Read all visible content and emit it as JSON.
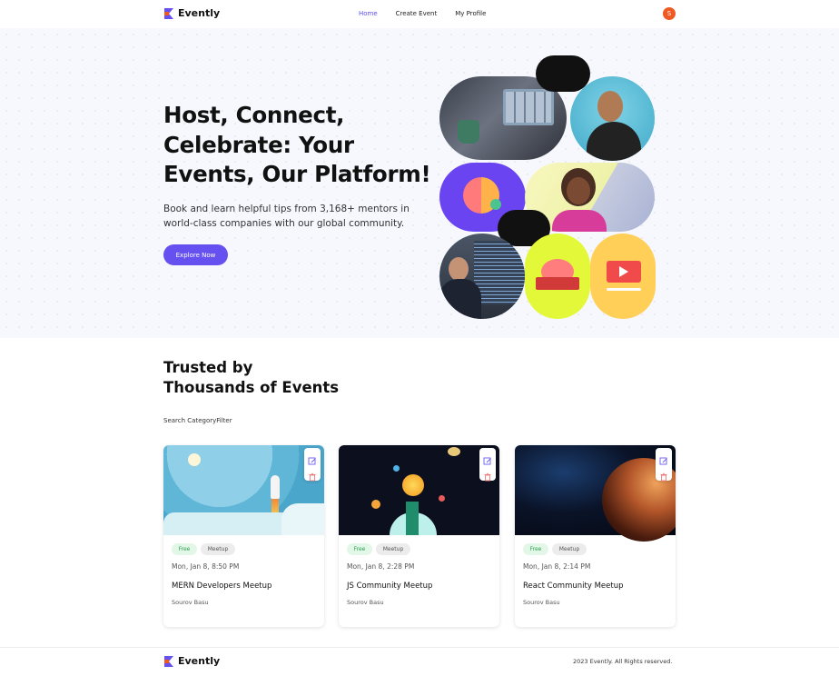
{
  "app": {
    "name": "Evently",
    "brand_color": "#6750f0",
    "logo_colors": [
      "#6750f0",
      "#ef5a24"
    ]
  },
  "nav": {
    "items": [
      {
        "label": "Home",
        "active": true
      },
      {
        "label": "Create Event",
        "active": false
      },
      {
        "label": "My Profile",
        "active": false
      }
    ],
    "avatar_initial": "S",
    "avatar_color": "#ef5a24"
  },
  "hero": {
    "title_lines": [
      "Host, Connect,",
      "Celebrate: Your",
      "Events, Our Platform!"
    ],
    "subtitle_lines": [
      "Book and learn helpful tips from 3,168+ mentors in",
      "world-class companies with our global community."
    ],
    "cta_label": "Explore Now",
    "emojis": [
      "😍",
      "😋"
    ]
  },
  "trusted": {
    "title_lines": [
      "Trusted by",
      "Thousands of Events"
    ],
    "search_label": "Search CategoryFilter"
  },
  "events": [
    {
      "price": "Free",
      "category": "Meetup",
      "date": "Mon, Jan 8, 8:50 PM",
      "title": "MERN Developers Meetup",
      "organizer": "Sourov Basu",
      "image": "rocket-illustration"
    },
    {
      "price": "Free",
      "category": "Meetup",
      "date": "Mon, Jan 8, 2:28 PM",
      "title": "JS Community Meetup",
      "organizer": "Sourov Basu",
      "image": "solar-system-illustration"
    },
    {
      "price": "Free",
      "category": "Meetup",
      "date": "Mon, Jan 8, 2:14 PM",
      "title": "React Community Meetup",
      "organizer": "Sourov Basu",
      "image": "planet-space-photo"
    }
  ],
  "footer": {
    "brand": "Evently",
    "copyright": "2023 Evently. All Rights reserved."
  }
}
